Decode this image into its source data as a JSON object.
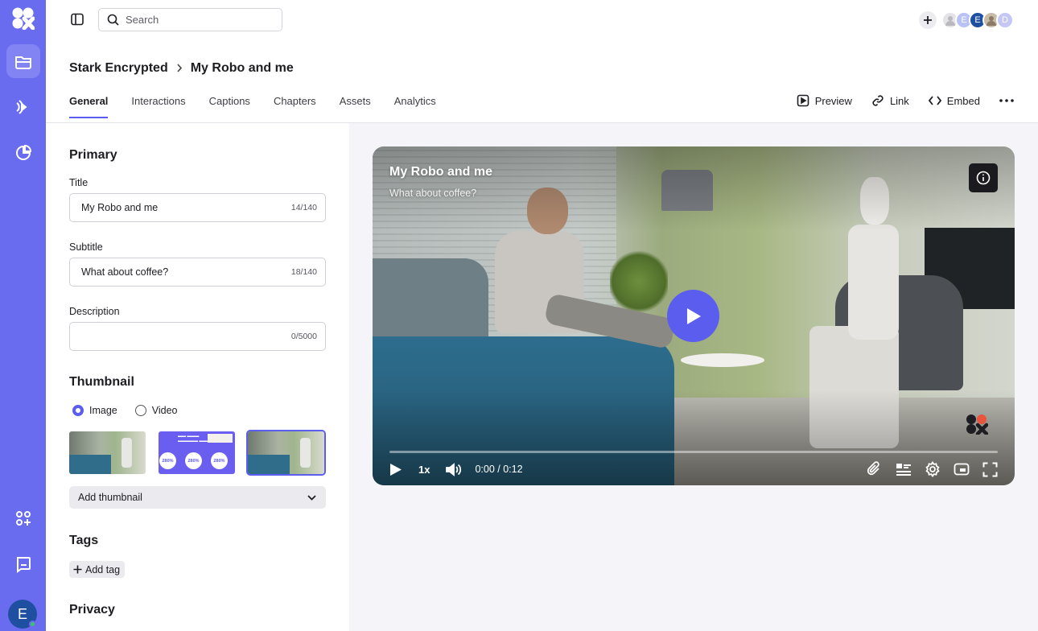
{
  "colors": {
    "rail": "#6a6cf0",
    "accent": "#5b5def",
    "preview_bg": "#f5f4f8"
  },
  "rail": {
    "items": [
      {
        "icon": "folder-icon",
        "active": true
      },
      {
        "icon": "broadcast-icon",
        "active": false
      },
      {
        "icon": "analytics-icon",
        "active": false
      },
      {
        "icon": "apps-add-icon",
        "active": false
      },
      {
        "icon": "chat-icon",
        "active": false
      }
    ],
    "user_initial": "E"
  },
  "topbar": {
    "search_placeholder": "Search",
    "avatars": [
      "E",
      "E",
      "D"
    ]
  },
  "breadcrumb": {
    "parent": "Stark Encrypted",
    "current": "My Robo and me"
  },
  "tabs": [
    "General",
    "Interactions",
    "Captions",
    "Chapters",
    "Assets",
    "Analytics"
  ],
  "actions": {
    "preview": "Preview",
    "link": "Link",
    "embed": "Embed"
  },
  "form": {
    "primary_heading": "Primary",
    "title_label": "Title",
    "title_value": "My Robo and me",
    "title_count": "14/140",
    "subtitle_label": "Subtitle",
    "subtitle_value": "What about coffee?",
    "subtitle_count": "18/140",
    "description_label": "Description",
    "description_value": "",
    "description_count": "0/5000",
    "thumbnail_heading": "Thumbnail",
    "radio_image": "Image",
    "radio_video": "Video",
    "thumb_promo_stat": "280%",
    "add_thumbnail": "Add thumbnail",
    "tags_heading": "Tags",
    "add_tag": "Add tag",
    "privacy_heading": "Privacy"
  },
  "player": {
    "title": "My Robo and me",
    "subtitle": "What about coffee?",
    "speed": "1x",
    "time": "0:00 / 0:12",
    "progress": 0
  }
}
